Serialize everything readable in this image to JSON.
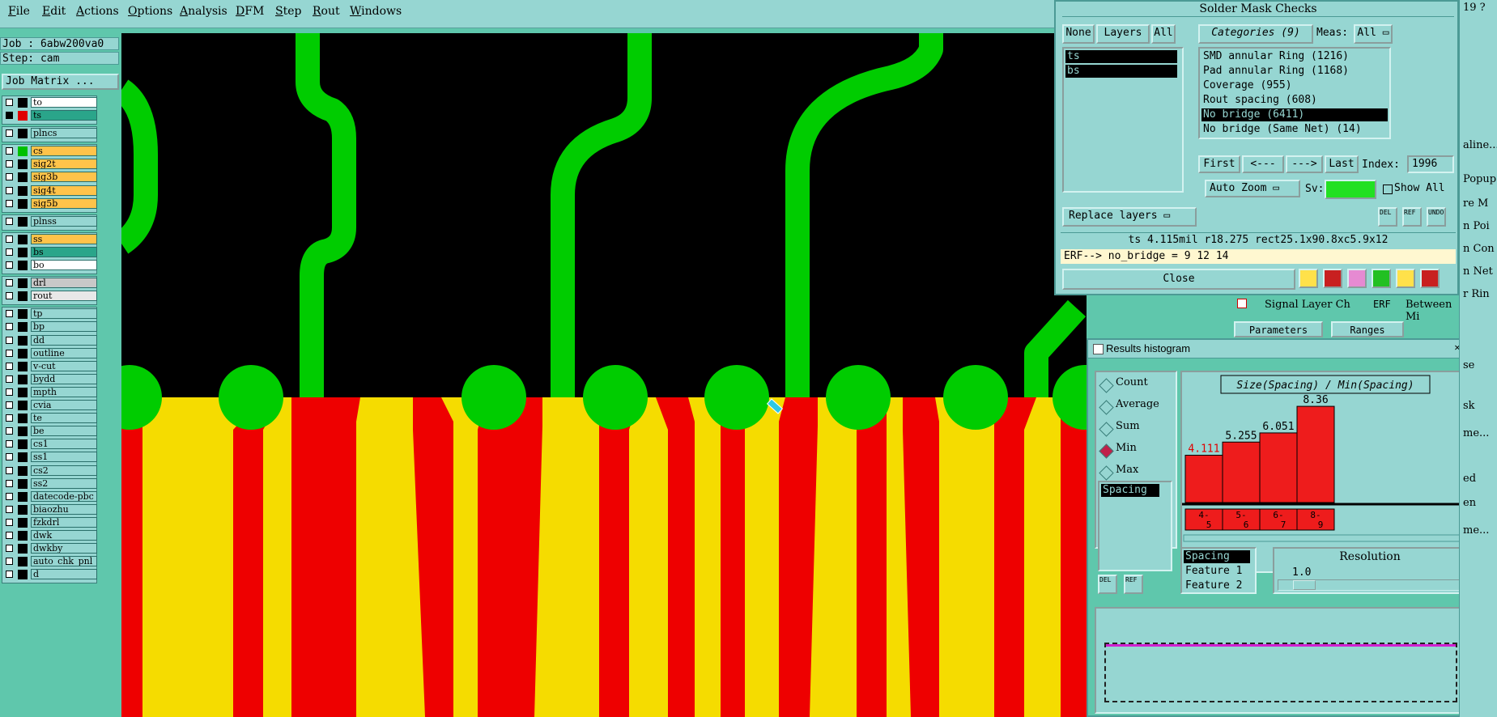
{
  "menu": [
    "File",
    "Edit",
    "Actions",
    "Options",
    "Analysis",
    "DFM",
    "Step",
    "Rout",
    "Windows"
  ],
  "job": {
    "job_line": "Job : 6abw200va0",
    "step_line": "Step: cam",
    "matrix_button": "Job Matrix ..."
  },
  "layers": [
    {
      "name": "to",
      "bg": "#ffffff",
      "color": null,
      "group": 1
    },
    {
      "name": "ts",
      "bg": "#2aa58a",
      "color": "#e00000",
      "active": true,
      "group": 1
    },
    {
      "name": "plncs",
      "bg": "#96d6d2",
      "color": null,
      "group": 2
    },
    {
      "name": "cs",
      "bg": "#ffc34a",
      "color": "#00c000",
      "group": 3
    },
    {
      "name": "sig2t",
      "bg": "#ffc34a",
      "color": null,
      "group": 3
    },
    {
      "name": "sig3b",
      "bg": "#ffc34a",
      "color": null,
      "group": 3
    },
    {
      "name": "sig4t",
      "bg": "#ffc34a",
      "color": null,
      "group": 3
    },
    {
      "name": "sig5b",
      "bg": "#ffc34a",
      "color": null,
      "group": 3
    },
    {
      "name": "plnss",
      "bg": "#96d6d2",
      "color": null,
      "group": 4
    },
    {
      "name": "ss",
      "bg": "#ffc34a",
      "color": null,
      "group": 5
    },
    {
      "name": "bs",
      "bg": "#2aa58a",
      "color": null,
      "group": 5
    },
    {
      "name": "bo",
      "bg": "#ffffff",
      "color": null,
      "group": 5
    },
    {
      "name": "drl",
      "bg": "#c8c8c8",
      "color": null,
      "group": 6
    },
    {
      "name": "rout",
      "bg": "#e8e8e8",
      "color": null,
      "group": 6
    },
    {
      "name": "tp",
      "bg": "#96d6d2",
      "color": null,
      "group": 7
    },
    {
      "name": "bp",
      "bg": "#96d6d2",
      "color": null,
      "group": 7
    },
    {
      "name": "dd",
      "bg": "#96d6d2",
      "color": null,
      "group": 7
    },
    {
      "name": "outline",
      "bg": "#96d6d2",
      "color": null,
      "group": 7
    },
    {
      "name": "v-cut",
      "bg": "#96d6d2",
      "color": null,
      "group": 7
    },
    {
      "name": "bydd",
      "bg": "#96d6d2",
      "color": null,
      "group": 7
    },
    {
      "name": "mpth",
      "bg": "#96d6d2",
      "color": null,
      "group": 7
    },
    {
      "name": "cvia",
      "bg": "#96d6d2",
      "color": null,
      "group": 7
    },
    {
      "name": "te",
      "bg": "#96d6d2",
      "color": null,
      "group": 7
    },
    {
      "name": "be",
      "bg": "#96d6d2",
      "color": null,
      "group": 7
    },
    {
      "name": "cs1",
      "bg": "#96d6d2",
      "color": null,
      "group": 7
    },
    {
      "name": "ss1",
      "bg": "#96d6d2",
      "color": null,
      "group": 7
    },
    {
      "name": "cs2",
      "bg": "#96d6d2",
      "color": null,
      "group": 7
    },
    {
      "name": "ss2",
      "bg": "#96d6d2",
      "color": null,
      "group": 7
    },
    {
      "name": "datecode-pbc",
      "bg": "#96d6d2",
      "color": null,
      "group": 7
    },
    {
      "name": "biaozhu",
      "bg": "#96d6d2",
      "color": null,
      "group": 7
    },
    {
      "name": "fzkdrl",
      "bg": "#96d6d2",
      "color": null,
      "group": 7
    },
    {
      "name": "dwk",
      "bg": "#96d6d2",
      "color": null,
      "group": 7
    },
    {
      "name": "dwkby",
      "bg": "#96d6d2",
      "color": null,
      "group": 7
    },
    {
      "name": "auto_chk_pnl",
      "bg": "#96d6d2",
      "color": null,
      "group": 7
    },
    {
      "name": "d",
      "bg": "#96d6d2",
      "color": null,
      "group": 7
    }
  ],
  "smc": {
    "title": "Solder Mask Checks",
    "none_btn": "None",
    "layers_btn": "Layers",
    "all_btn": "All",
    "categories_btn": "Categories (9)",
    "meas_label": "Meas:",
    "meas_value": "All",
    "layer_list": [
      "ts",
      "bs"
    ],
    "categories": [
      "SMD annular Ring (1216)",
      "Pad annular Ring (1168)",
      "Coverage (955)",
      "Rout spacing (608)",
      "No bridge (6411)",
      "No bridge (Same Net) (14)"
    ],
    "selected_category": 4,
    "first": "First",
    "prev": "<---",
    "next": "--->",
    "last": "Last",
    "index_label": "Index:",
    "index_value": "1996",
    "auto_zoom": "Auto Zoom",
    "sv_label": "Sv:",
    "show_all": "Show All",
    "replace_layers": "Replace layers",
    "del": "DEL",
    "ref": "REF",
    "undo": "UNDO",
    "feature_info": "ts 4.115mil  r18.275  rect25.1x90.8xc5.9x12",
    "erf_info": "ERF--> no_bridge = 9 12 14",
    "close": "Close"
  },
  "behind": {
    "signal_layer": "Signal Layer Ch",
    "erf": "ERF",
    "between": "Between Mi",
    "parameters": "Parameters",
    "ranges": "Ranges"
  },
  "hist": {
    "title": "Results histogram",
    "heading": "Size(Spacing) / Min(Spacing)",
    "modes": [
      "Count",
      "Average",
      "Sum",
      "Min",
      "Max"
    ],
    "selected_mode": 3,
    "left_list": [
      "Spacing"
    ],
    "del": "DEL",
    "ref": "REF",
    "sub_list": [
      "Spacing",
      "Feature 1",
      "Feature 2"
    ],
    "resolution_label": "Resolution",
    "resolution_value": "1.0"
  },
  "chart_data": {
    "type": "bar",
    "title": "Size(Spacing) / Min(Spacing)",
    "categories": [
      "4-5",
      "5-6",
      "6-7",
      "8-9"
    ],
    "values": [
      4.111,
      5.255,
      6.051,
      8.36
    ],
    "value_labels": [
      "4.111",
      "5.255",
      "6.051",
      "8.36"
    ],
    "bar_color": "#ee1c1c",
    "ylim": [
      0,
      9.0
    ]
  },
  "peek": {
    "lines": [
      "19 ?",
      "aline...",
      "Popup",
      "re M",
      "n Poi",
      "n Con",
      "n Net",
      "r Rin",
      "se",
      "sk",
      "me...",
      "ed",
      "en",
      "me..."
    ]
  },
  "colors": {
    "copper": "#00cc00",
    "mask": "#ee0000",
    "pad": "#f5dc00",
    "canvas": "#000000",
    "panel": "#96d6d2",
    "bg": "#5fc7ac"
  }
}
